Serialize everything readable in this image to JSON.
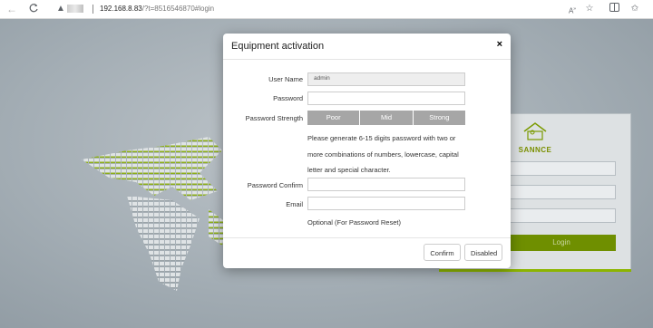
{
  "browser": {
    "url_host": "192.168.8.83",
    "url_rest": "/?t=8516546870#login"
  },
  "modal": {
    "title": "Equipment activation",
    "close_label": "×",
    "fields": {
      "username_label": "User Name",
      "username_value": "admin",
      "password_label": "Password",
      "strength_label": "Password Strength",
      "confirm_label": "Password Confirm",
      "email_label": "Email"
    },
    "strength_levels": [
      "Poor",
      "Mid",
      "Strong"
    ],
    "hint_lines": [
      "Please generate 6-15 digits password with two or",
      "more combinations of numbers, lowercase, capital",
      "letter and special character."
    ],
    "optional_note": "Optional (For Password Reset)",
    "confirm_button": "Confirm",
    "disabled_button": "Disabled"
  },
  "background_login": {
    "brand": "SANNCE",
    "login_button": "Login",
    "accent_color": "#7a9a00"
  },
  "icons": [
    "back-icon",
    "forward-icon",
    "reload-icon",
    "not-secure-warning-icon",
    "read-aloud-icon",
    "favorite-star-icon",
    "split-screen-icon",
    "favorites-icon"
  ]
}
